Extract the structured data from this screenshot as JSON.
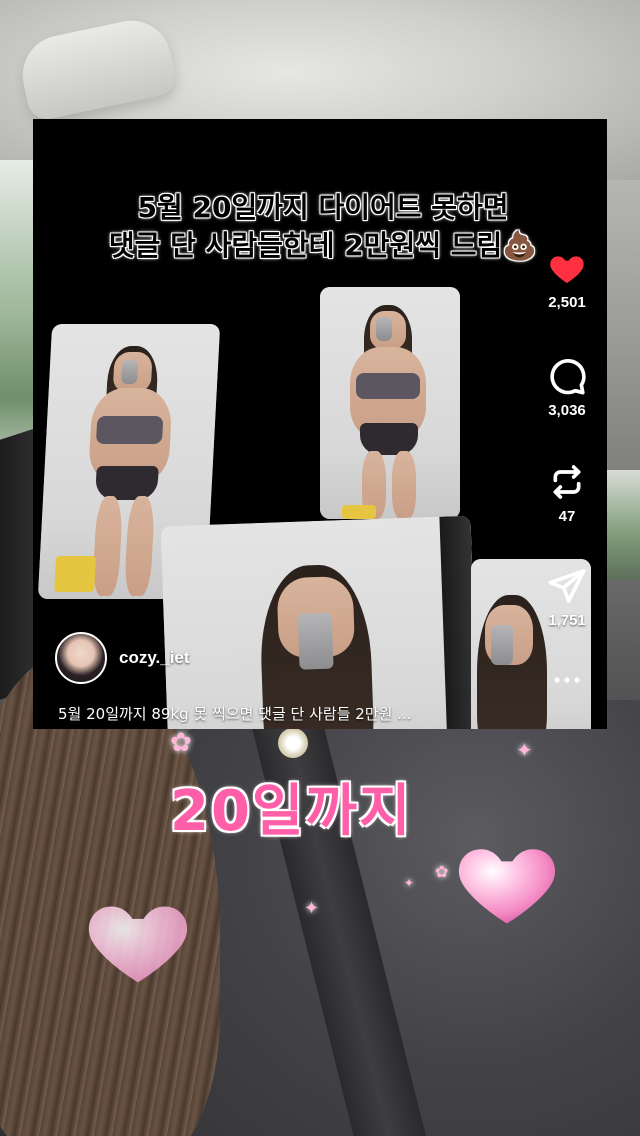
{
  "reel": {
    "title_line1": "5월 20일까지 다이어트 못하면",
    "title_line2": "댓글 단 사람들한테 2만원씩 드림💩",
    "author": {
      "username": "cozy._iet"
    },
    "caption": "5월 20일까지 89kg 못 찍으면 댓글 단 사람들 2만원 ..."
  },
  "actions": {
    "like": {
      "icon": "heart-icon",
      "count": "2,501",
      "color": "#ff3040"
    },
    "comment": {
      "icon": "comment-icon",
      "count": "3,036"
    },
    "repost": {
      "icon": "repost-icon",
      "count": "47"
    },
    "share": {
      "icon": "send-icon",
      "count": "1,751"
    },
    "more": {
      "icon": "more-icon"
    }
  },
  "overlay": {
    "text": "20일까지",
    "text_color": "#ff5fa8"
  }
}
